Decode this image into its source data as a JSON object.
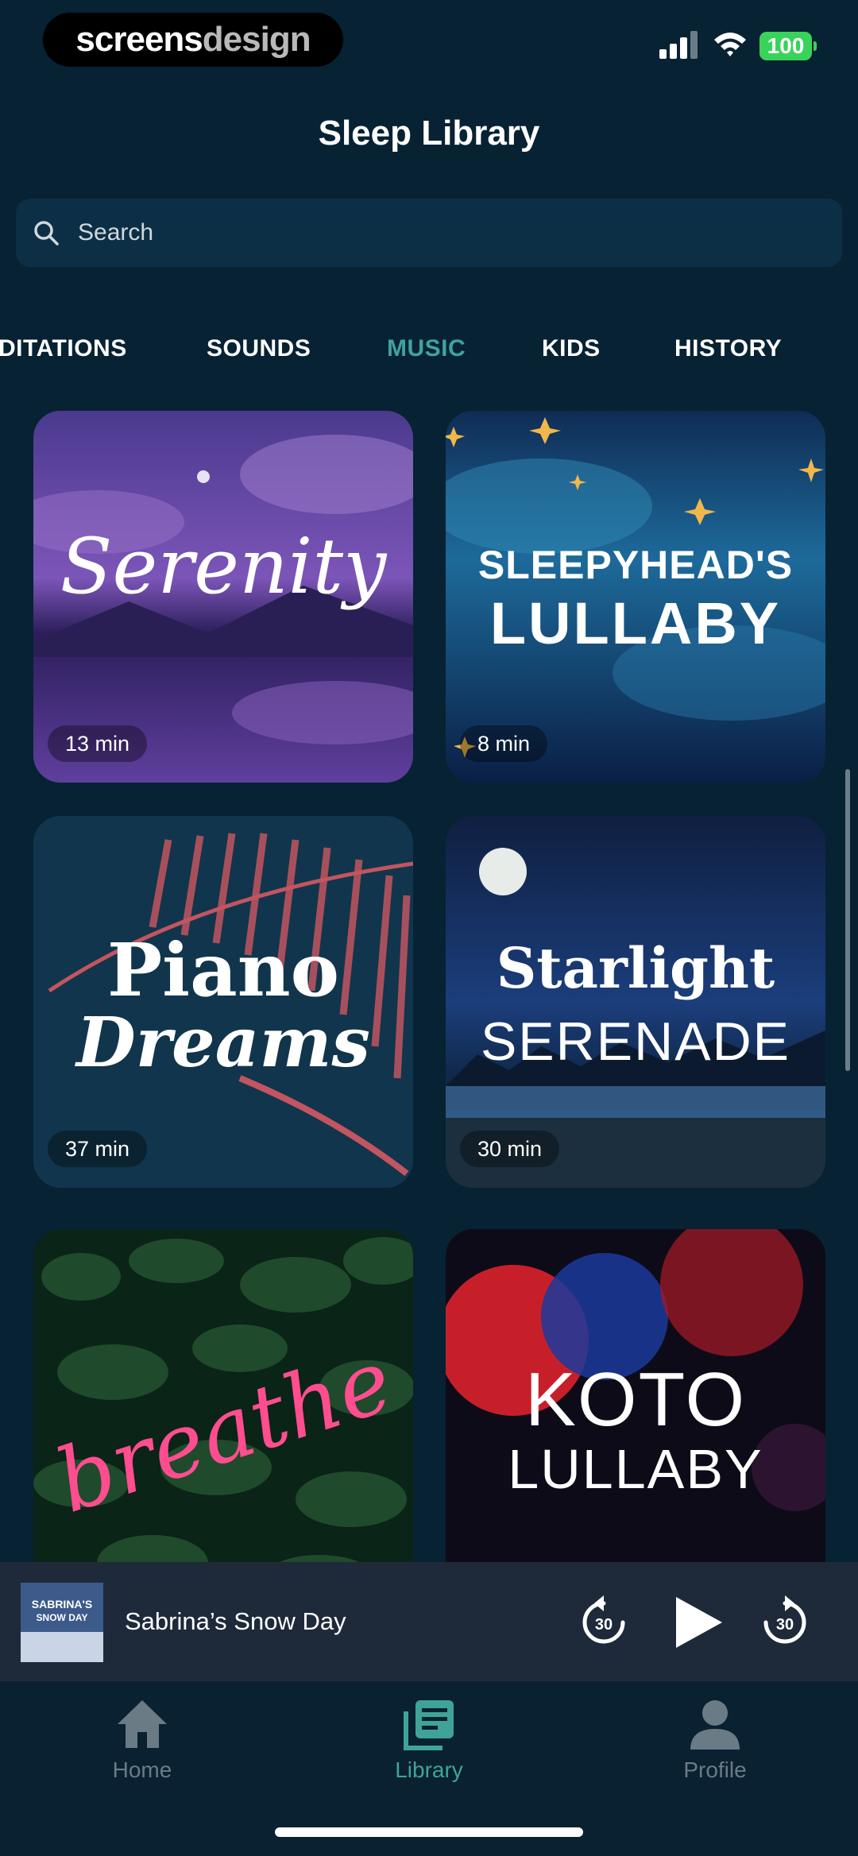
{
  "status_bar": {
    "watermark_a": "screens",
    "watermark_b": "design",
    "battery": "100"
  },
  "header": {
    "title": "Sleep Library"
  },
  "search": {
    "placeholder": "Search"
  },
  "tabs": [
    {
      "label": "DITATIONS",
      "active": false
    },
    {
      "label": "SOUNDS",
      "active": false
    },
    {
      "label": "MUSIC",
      "active": true
    },
    {
      "label": "KIDS",
      "active": false
    },
    {
      "label": "HISTORY",
      "active": false
    }
  ],
  "cards": [
    {
      "art_text": [
        "Serenity"
      ],
      "duration": "13 min",
      "palette": "#5a3f9e"
    },
    {
      "art_text": [
        "SLEEPYHEAD'S",
        "LULLABY"
      ],
      "duration": "8 min",
      "palette": "#1a4a8a"
    },
    {
      "art_text": [
        "Piano",
        "Dreams"
      ],
      "duration": "37 min",
      "palette": "#10344a"
    },
    {
      "art_text": [
        "Starlight",
        "SERENADE"
      ],
      "duration": "30 min",
      "palette": "#0d2a52"
    },
    {
      "art_text": [
        "breathe"
      ],
      "duration": "",
      "palette": "#0c2b1c"
    },
    {
      "art_text": [
        "KOTO",
        "LULLABY"
      ],
      "duration": "",
      "palette": "#151020"
    }
  ],
  "mini_player": {
    "title": "Sabrina’s Snow Day",
    "art_text": [
      "SABRINA'S",
      "SNOW DAY"
    ],
    "rewind_label": "30",
    "forward_label": "30"
  },
  "bottom_nav": [
    {
      "label": "Home",
      "icon": "home-icon",
      "active": false
    },
    {
      "label": "Library",
      "icon": "library-icon",
      "active": true
    },
    {
      "label": "Profile",
      "icon": "profile-icon",
      "active": false
    }
  ],
  "colors": {
    "accent": "#3fa39c",
    "background": "#072233",
    "inactive": "#6a7b86"
  }
}
